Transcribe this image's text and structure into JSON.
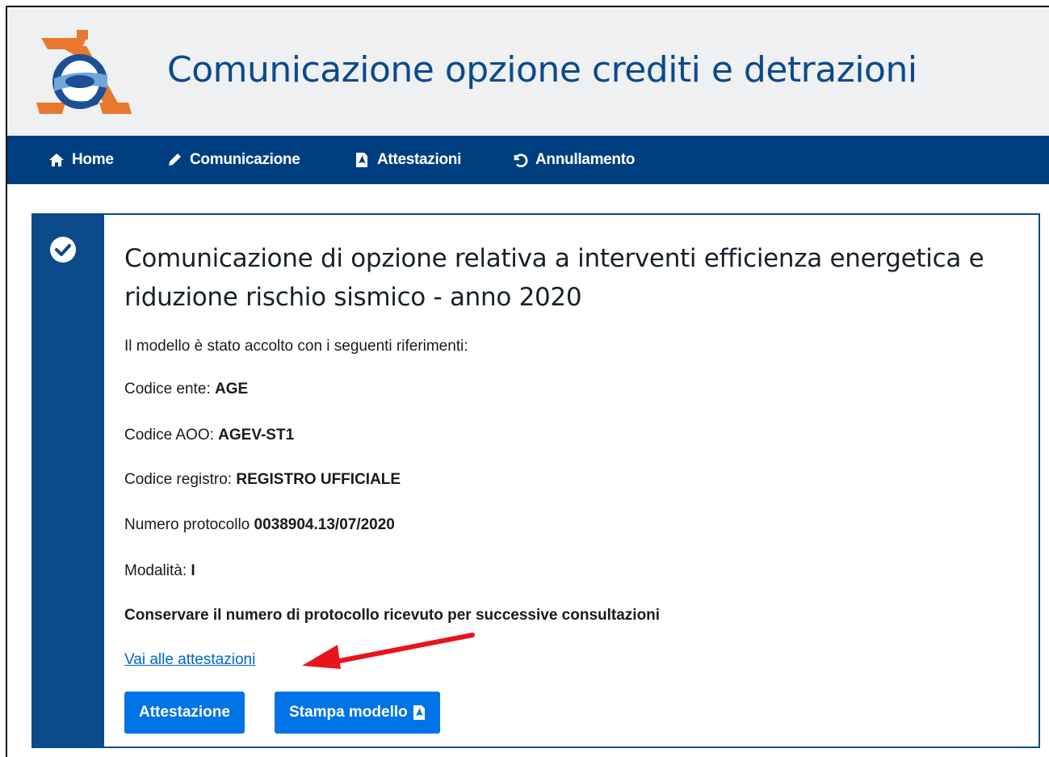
{
  "header": {
    "title": "Comunicazione opzione crediti e detrazioni",
    "logo_icon": "agenzia-entrate-logo"
  },
  "nav": {
    "items": [
      {
        "label": "Home",
        "icon": "home-icon"
      },
      {
        "label": "Comunicazione",
        "icon": "pencil-icon"
      },
      {
        "label": "Attestazioni",
        "icon": "pdf-file-icon"
      },
      {
        "label": "Annullamento",
        "icon": "undo-icon"
      }
    ]
  },
  "card": {
    "title": "Comunicazione di opzione relativa a interventi efficienza energetica e riduzione rischio sismico - anno 2020",
    "intro": "Il modello è stato accolto con i seguenti riferimenti:",
    "fields": [
      {
        "label": "Codice ente: ",
        "value": "AGE"
      },
      {
        "label": "Codice AOO: ",
        "value": "AGEV-ST1"
      },
      {
        "label": "Codice registro: ",
        "value": "REGISTRO UFFICIALE"
      },
      {
        "label": "Numero protocollo ",
        "value": "0038904.13/07/2020"
      },
      {
        "label": "Modalità: ",
        "value": "I"
      }
    ],
    "notice": "Conservare il numero di protocollo ricevuto per successive consultazioni",
    "link": "Vai alle attestazioni",
    "buttons": {
      "attestazione": "Attestazione",
      "stampa": "Stampa modello"
    }
  },
  "colors": {
    "nav_bg": "#003f7f",
    "title_blue": "#0b4a8b",
    "button_blue": "#0073e6",
    "link_blue": "#0066cc",
    "annotation_red": "#e8141c"
  }
}
